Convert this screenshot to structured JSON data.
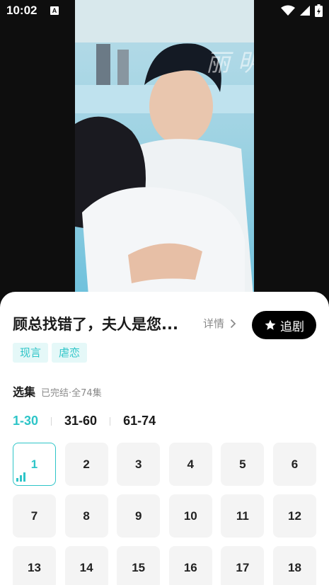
{
  "status_bar": {
    "time": "10:02",
    "notification_badge": "A",
    "icons": [
      "wifi-icon",
      "signal-icon",
      "battery-icon"
    ]
  },
  "video": {
    "watermark": "丽 明"
  },
  "drama": {
    "title": "顾总找错了，夫人是您...",
    "details_label": "详情",
    "follow_label": "追剧",
    "tags": [
      "现言",
      "虐恋"
    ]
  },
  "episodes": {
    "title": "选集",
    "status": "已完结·全74集",
    "ranges": [
      "1-30",
      "31-60",
      "61-74"
    ],
    "active_range": "1-30",
    "current_episode": "1",
    "visible": [
      "1",
      "2",
      "3",
      "4",
      "5",
      "6",
      "7",
      "8",
      "9",
      "10",
      "11",
      "12",
      "13",
      "14",
      "15",
      "16",
      "17",
      "18"
    ]
  },
  "colors": {
    "accent": "#2ec5c8",
    "tag_background": "#e5f8f8",
    "cell_background": "#f4f4f4",
    "follow_button": "#000000"
  }
}
